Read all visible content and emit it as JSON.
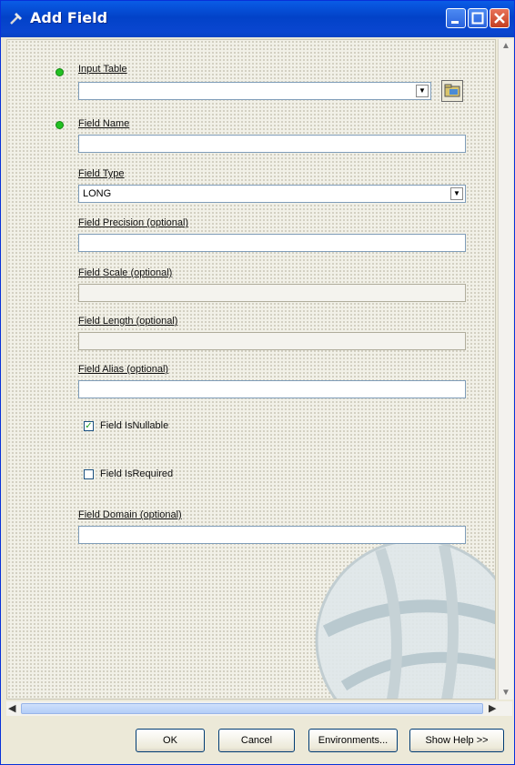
{
  "window": {
    "title": "Add Field",
    "icon": "hammer-icon",
    "controls": [
      "minimize-icon",
      "maximize-icon",
      "close-icon"
    ]
  },
  "form": {
    "input_table": {
      "label": "Input Table",
      "value": "",
      "required": true
    },
    "field_name": {
      "label": "Field Name",
      "value": "",
      "required": true
    },
    "field_type": {
      "label": "Field Type",
      "value": "LONG"
    },
    "field_precision": {
      "label": "Field Precision (optional)",
      "value": ""
    },
    "field_scale": {
      "label": "Field Scale (optional)",
      "value": ""
    },
    "field_length": {
      "label": "Field Length (optional)",
      "value": ""
    },
    "field_alias": {
      "label": "Field Alias (optional)",
      "value": ""
    },
    "field_is_nullable": {
      "label": "Field IsNullable",
      "checked": true
    },
    "field_is_required": {
      "label": "Field IsRequired",
      "checked": false
    },
    "field_domain": {
      "label": "Field Domain (optional)",
      "value": ""
    }
  },
  "buttons": {
    "ok": "OK",
    "cancel": "Cancel",
    "environments": "Environments...",
    "show_help": "Show Help >>"
  },
  "colors": {
    "titlebar": "#0842c6",
    "required_dot": "#22c022"
  }
}
